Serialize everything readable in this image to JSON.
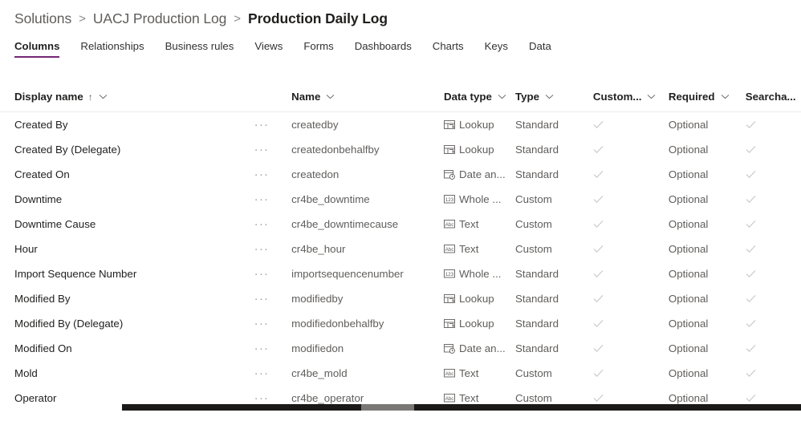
{
  "breadcrumb": {
    "items": [
      {
        "label": "Solutions",
        "current": false
      },
      {
        "label": "UACJ Production Log",
        "current": false
      },
      {
        "label": "Production Daily Log",
        "current": true
      }
    ],
    "separator": ">"
  },
  "tabs": [
    {
      "label": "Columns",
      "active": true
    },
    {
      "label": "Relationships",
      "active": false
    },
    {
      "label": "Business rules",
      "active": false
    },
    {
      "label": "Views",
      "active": false
    },
    {
      "label": "Forms",
      "active": false
    },
    {
      "label": "Dashboards",
      "active": false
    },
    {
      "label": "Charts",
      "active": false
    },
    {
      "label": "Keys",
      "active": false
    },
    {
      "label": "Data",
      "active": false
    }
  ],
  "grid": {
    "columns": [
      {
        "key": "display_name",
        "label": "Display name",
        "sort": "ascending",
        "sort_glyph": "↑",
        "has_menu": true
      },
      {
        "key": "name",
        "label": "Name",
        "sort": null,
        "has_menu": true
      },
      {
        "key": "data_type",
        "label": "Data type",
        "sort": null,
        "has_menu": true
      },
      {
        "key": "type",
        "label": "Type",
        "sort": null,
        "has_menu": true
      },
      {
        "key": "customizable",
        "label": "Custom...",
        "sort": null,
        "has_menu": true
      },
      {
        "key": "required",
        "label": "Required",
        "sort": null,
        "has_menu": true
      },
      {
        "key": "searchable",
        "label": "Searcha...",
        "sort": null,
        "has_menu": false
      }
    ],
    "row_menu_glyph": "···",
    "rows": [
      {
        "display_name": "Created By",
        "name": "createdby",
        "data_type": "Lookup",
        "data_type_icon": "lookup-icon",
        "type": "Standard",
        "customizable": true,
        "required": "Optional",
        "searchable": true
      },
      {
        "display_name": "Created By (Delegate)",
        "name": "createdonbehalfby",
        "data_type": "Lookup",
        "data_type_icon": "lookup-icon",
        "type": "Standard",
        "customizable": true,
        "required": "Optional",
        "searchable": true
      },
      {
        "display_name": "Created On",
        "name": "createdon",
        "data_type": "Date an...",
        "data_type_icon": "date-time-icon",
        "type": "Standard",
        "customizable": true,
        "required": "Optional",
        "searchable": true
      },
      {
        "display_name": "Downtime",
        "name": "cr4be_downtime",
        "data_type": "Whole ...",
        "data_type_icon": "whole-number-icon",
        "type": "Custom",
        "customizable": true,
        "required": "Optional",
        "searchable": true
      },
      {
        "display_name": "Downtime Cause",
        "name": "cr4be_downtimecause",
        "data_type": "Text",
        "data_type_icon": "text-icon",
        "type": "Custom",
        "customizable": true,
        "required": "Optional",
        "searchable": true
      },
      {
        "display_name": "Hour",
        "name": "cr4be_hour",
        "data_type": "Text",
        "data_type_icon": "text-icon",
        "type": "Custom",
        "customizable": true,
        "required": "Optional",
        "searchable": true
      },
      {
        "display_name": "Import Sequence Number",
        "name": "importsequencenumber",
        "data_type": "Whole ...",
        "data_type_icon": "whole-number-icon",
        "type": "Standard",
        "customizable": true,
        "required": "Optional",
        "searchable": true
      },
      {
        "display_name": "Modified By",
        "name": "modifiedby",
        "data_type": "Lookup",
        "data_type_icon": "lookup-icon",
        "type": "Standard",
        "customizable": true,
        "required": "Optional",
        "searchable": true
      },
      {
        "display_name": "Modified By (Delegate)",
        "name": "modifiedonbehalfby",
        "data_type": "Lookup",
        "data_type_icon": "lookup-icon",
        "type": "Standard",
        "customizable": true,
        "required": "Optional",
        "searchable": true
      },
      {
        "display_name": "Modified On",
        "name": "modifiedon",
        "data_type": "Date an...",
        "data_type_icon": "date-time-icon",
        "type": "Standard",
        "customizable": true,
        "required": "Optional",
        "searchable": true
      },
      {
        "display_name": "Mold",
        "name": "cr4be_mold",
        "data_type": "Text",
        "data_type_icon": "text-icon",
        "type": "Custom",
        "customizable": true,
        "required": "Optional",
        "searchable": true
      },
      {
        "display_name": "Operator",
        "name": "cr4be_operator",
        "data_type": "Text",
        "data_type_icon": "text-icon",
        "type": "Custom",
        "customizable": true,
        "required": "Optional",
        "searchable": true
      }
    ]
  },
  "colors": {
    "accent": "#742774",
    "text_primary": "#201f1e",
    "text_secondary": "#605e5c",
    "text_muted": "#a19f9d",
    "divider": "#edebe9",
    "scrollbar_track": "#1b1a19",
    "scrollbar_thumb": "#7a7875"
  }
}
